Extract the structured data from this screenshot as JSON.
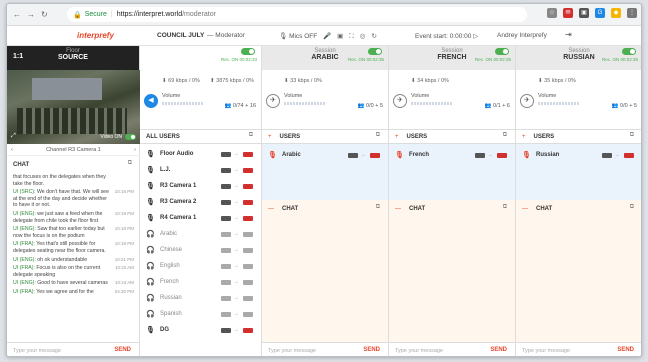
{
  "browser": {
    "secure_label": "Secure",
    "url_host": "https://interpret.world",
    "url_path": "/moderator"
  },
  "topbar": {
    "logo_text": "interprefy",
    "session_name": "COUNCIL JULY",
    "role": "— Moderator",
    "mics": "Mics OFF",
    "event_start_label": "Event start:",
    "event_start_time": "0:00:00",
    "user_name": "Andrey Interprefy"
  },
  "floor": {
    "badge": "1:1",
    "label_small": "Floor",
    "label": "SOURCE",
    "rec": "Rec. ON 00:02:33",
    "video_label": "Video ON",
    "channel": "Channel R3 Camera 1",
    "kbps_in": "69 kbps / 0%",
    "kbps_out": "3875 kbps / 0%",
    "volume_label": "Volume",
    "count": "0/74 + 16",
    "users_title": "ALL USERS",
    "chat_title": "CHAT",
    "message_placeholder": "Type your message",
    "send_label": "SEND"
  },
  "users": [
    {
      "name": "Floor Audio",
      "active": true,
      "icon": "mic-icon"
    },
    {
      "name": "L.J.",
      "active": true,
      "icon": "mic-icon"
    },
    {
      "name": "R3 Camera 1",
      "active": true,
      "icon": "mic-icon"
    },
    {
      "name": "R3 Camera 2",
      "active": true,
      "icon": "mic-icon"
    },
    {
      "name": "R4 Camera 1",
      "active": true,
      "icon": "mic-icon"
    },
    {
      "name": "Arabic",
      "active": false,
      "icon": "headphones-icon"
    },
    {
      "name": "Chinese",
      "active": false,
      "icon": "headphones-icon"
    },
    {
      "name": "English",
      "active": false,
      "icon": "headphones-icon"
    },
    {
      "name": "French",
      "active": false,
      "icon": "headphones-icon"
    },
    {
      "name": "Russian",
      "active": false,
      "icon": "headphones-icon"
    },
    {
      "name": "Spanish",
      "active": false,
      "icon": "headphones-icon"
    },
    {
      "name": "DG",
      "active": true,
      "icon": "mic-icon"
    }
  ],
  "messages": [
    {
      "who": "",
      "text": "that focuses on the delegates when they take the floor.",
      "time": ""
    },
    {
      "who": "UI (SRC):",
      "text": "We don't have that. We will see at the end of the day and decide whether to have it or not.",
      "time": "10:16 PM"
    },
    {
      "who": "UI (ENG):",
      "text": "we just saw a feed when the delegate from chile took the floor first",
      "time": "10:18 PM"
    },
    {
      "who": "UI (ENG):",
      "text": "Saw that too earlier today but now the focus is on the podium",
      "time": "10:18 PM"
    },
    {
      "who": "UI (FRA):",
      "text": "Yes that's still possible for delegates seating near the floor camera.",
      "time": "10:19 PM"
    },
    {
      "who": "UI (ENG):",
      "text": "oh ok understandable",
      "time": "10:21 PM"
    },
    {
      "who": "UI (FRA):",
      "text": "Focus is also on the current delegate speaking",
      "time": "10:22 AM"
    },
    {
      "who": "UI (ENG):",
      "text": "Good to have several cameras",
      "time": "10:23 AM"
    },
    {
      "who": "UI (FRA):",
      "text": "Yes we agree and for the",
      "time": "04:30 PM"
    }
  ],
  "sessions": [
    {
      "label_small": "Session",
      "name": "ARABIC",
      "rec": "Rec. ON 00:02:35",
      "kbps": "33 kbps / 0%",
      "volume_label": "Volume",
      "count": "0/0 + 5",
      "users_title": "USERS",
      "user": "Arabic",
      "chat_title": "CHAT",
      "placeholder": "Type your message",
      "send": "SEND"
    },
    {
      "label_small": "Session",
      "name": "FRENCH",
      "rec": "Rec. ON 00:02:35",
      "kbps": "34 kbps / 0%",
      "volume_label": "Volume",
      "count": "0/1 + 6",
      "users_title": "USERS",
      "user": "French",
      "chat_title": "CHAT",
      "placeholder": "Type your message",
      "send": "SEND"
    },
    {
      "label_small": "Session",
      "name": "RUSSIAN",
      "rec": "Rec. ON 00:02:35",
      "kbps": "35 kbps / 0%",
      "volume_label": "Volume",
      "count": "0/0 + 5",
      "users_title": "USERS",
      "user": "Russian",
      "chat_title": "CHAT",
      "placeholder": "Type your message",
      "send": "SEND"
    }
  ],
  "colors": {
    "accent": "#e8462c",
    "active": "#4caf50",
    "blue": "#1e88e5",
    "floor_bg": "#eaf3fb",
    "lang_bg": "#fff7ee"
  }
}
